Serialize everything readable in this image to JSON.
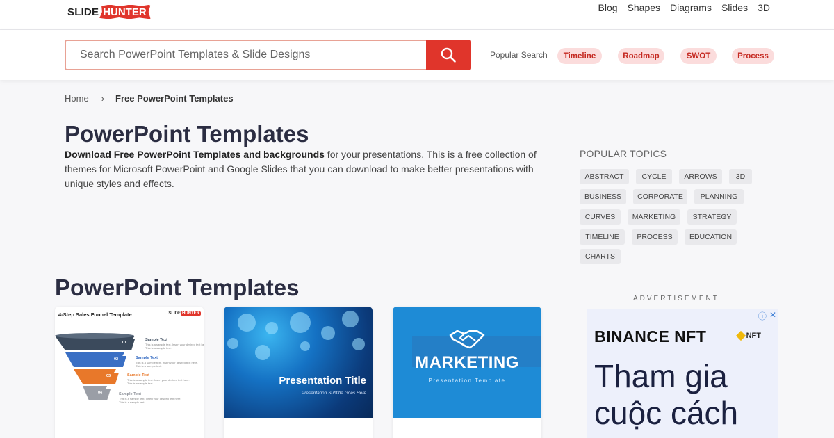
{
  "header": {
    "logo": {
      "part1": "SLIDE",
      "part2": "HUNTER"
    },
    "nav": [
      "Blog",
      "Shapes",
      "Diagrams",
      "Slides",
      "3D"
    ]
  },
  "search": {
    "placeholder": "Search PowerPoint Templates & Slide Designs",
    "popular_label": "Popular Search",
    "chips": [
      "Timeline",
      "Roadmap",
      "SWOT",
      "Process"
    ]
  },
  "breadcrumb": {
    "home": "Home",
    "separator": "›",
    "current": "Free PowerPoint Templates"
  },
  "page": {
    "title": "PowerPoint Templates",
    "intro_bold": "Download Free PowerPoint Templates and backgrounds",
    "intro_rest": " for your presentations. This is a free collection of themes for Microsoft PowerPoint and Google Slides that you can download to make better presentations with unique styles and effects."
  },
  "topics": {
    "title": "POPULAR TOPICS",
    "tags": [
      "ABSTRACT",
      "CYCLE",
      "ARROWS",
      "3D",
      "BUSINESS",
      "CORPORATE",
      "PLANNING",
      "CURVES",
      "MARKETING",
      "STRATEGY",
      "TIMELINE",
      "PROCESS",
      "EDUCATION",
      "CHARTS"
    ]
  },
  "section": {
    "title": "PowerPoint Templates"
  },
  "cards": [
    {
      "title": "4-Step Sales Funnel Template",
      "logo": {
        "part1": "SLIDE",
        "part2": "HUNTER"
      },
      "steps": [
        {
          "num": "01",
          "label": "Sample Text",
          "text": "This is a sample text. Insert your desired text here. This is a sample text.",
          "color": "#3b4a5c"
        },
        {
          "num": "02",
          "label": "Sample Text",
          "text": "This is a sample text. Insert your desired text here. This is a sample text.",
          "color": "#3a6fc4"
        },
        {
          "num": "03",
          "label": "Sample Text",
          "text": "This is a sample text. Insert your desired text here. This is a sample text.",
          "color": "#e8782a"
        },
        {
          "num": "04",
          "label": "Sample Text",
          "text": "This is a sample text. Insert your desired text here. This is a sample text.",
          "color": "#9a9ea6"
        }
      ]
    },
    {
      "title": "Presentation Title",
      "subtitle": "Presentation Subtitle Goes Here"
    },
    {
      "title": "MARKETING",
      "subtitle": "Presentation Template"
    }
  ],
  "ad": {
    "label": "ADVERTISEMENT",
    "brand": "BINANCE NFT",
    "badge": "NFT",
    "body_line1": "Tham gia",
    "body_line2": "cuộc cách"
  }
}
